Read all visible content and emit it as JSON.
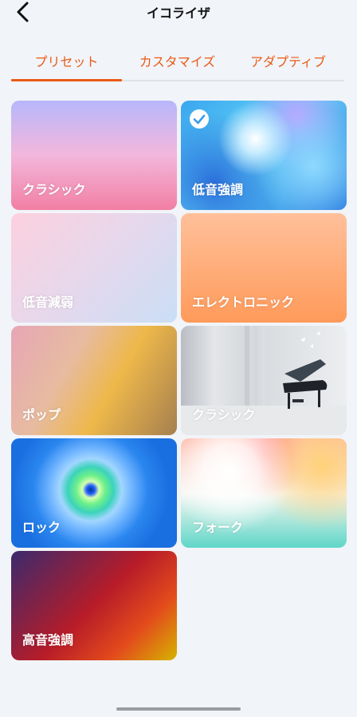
{
  "header": {
    "title": "イコライザ",
    "back_icon": "chevron-left-icon"
  },
  "tabs": [
    {
      "label": "プリセット",
      "selected": true
    },
    {
      "label": "カスタマイズ",
      "selected": false
    },
    {
      "label": "アダプティブ",
      "selected": false
    }
  ],
  "accent_color": "#ea5a17",
  "presets": [
    {
      "label": "クラシック",
      "selected": false
    },
    {
      "label": "低音強調",
      "selected": true
    },
    {
      "label": "低音減弱",
      "selected": false
    },
    {
      "label": "エレクトロニック",
      "selected": false
    },
    {
      "label": "ポップ",
      "selected": false
    },
    {
      "label": "クラシック",
      "selected": false
    },
    {
      "label": "ロック",
      "selected": false
    },
    {
      "label": "フォーク",
      "selected": false
    },
    {
      "label": "高音強調",
      "selected": false
    }
  ]
}
